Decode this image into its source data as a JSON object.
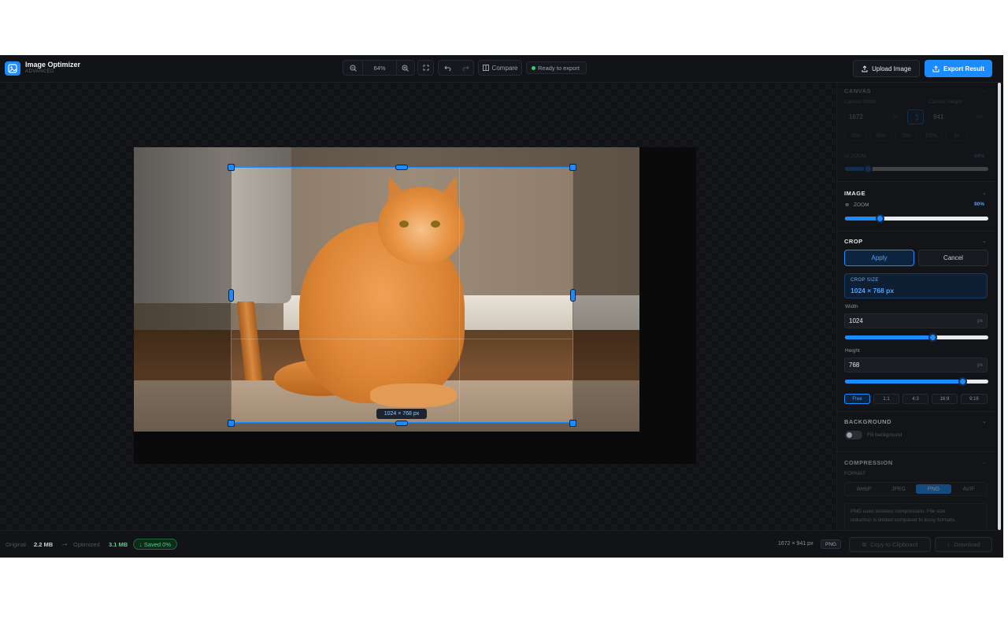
{
  "app": {
    "title": "Image Optimizer",
    "subtitle": "ADVANCED"
  },
  "toolbar": {
    "zoom_value": "64%",
    "compare_label": "Compare",
    "status_text": "Ready to export",
    "upload_label": "Upload Image",
    "export_label": "Export Result"
  },
  "editor": {
    "crop_label": "1024 × 768 px"
  },
  "panel": {
    "canvas": {
      "title": "CANVAS",
      "width_label": "Canvas Width",
      "width_value": "1672",
      "height_label": "Canvas Height",
      "height_value": "941",
      "unit": "px",
      "presets": [
        "25%",
        "50%",
        "75%",
        "100%",
        "2x"
      ],
      "zoom_label": "UI ZOOM",
      "zoom_value": "64%",
      "zoom_fraction": 0.16
    },
    "image": {
      "title": "IMAGE",
      "zoom_label": "ZOOM",
      "zoom_value": "90%",
      "zoom_fraction": 0.24
    },
    "crop": {
      "title": "CROP",
      "apply_label": "Apply",
      "cancel_label": "Cancel",
      "size_label": "CROP SIZE",
      "size_value": "1024 × 768 px",
      "width_label": "Width",
      "width_value": "1024",
      "width_fraction": 0.61,
      "height_label": "Height",
      "height_value": "768",
      "height_fraction": 0.82,
      "unit": "px",
      "ratios": [
        "Free",
        "1:1",
        "4:3",
        "16:9",
        "9:16"
      ],
      "active_ratio": "Free"
    },
    "background": {
      "title": "BACKGROUND",
      "toggle_label": "Fill background"
    },
    "compression": {
      "title": "COMPRESSION",
      "format_label": "FORMAT",
      "formats": [
        "WebP",
        "JPEG",
        "PNG",
        "AVIF"
      ],
      "active_format": "PNG",
      "note_line1": "PNG uses lossless compression. File size",
      "note_line2": "reduction is limited compared to lossy formats."
    }
  },
  "footer": {
    "original_label": "Original",
    "original_size": "2.2 MB",
    "optimized_label": "Optimized",
    "optimized_size": "3.1 MB",
    "saved_text": "↓ Saved 0%",
    "dimensions": "1672 × 941 px",
    "format_badge": "PNG",
    "copy_label": "Copy to Clipboard",
    "download_label": "Download"
  },
  "colors": {
    "accent": "#1a8cff",
    "success": "#3ddc78",
    "background": "#0d0f12"
  }
}
